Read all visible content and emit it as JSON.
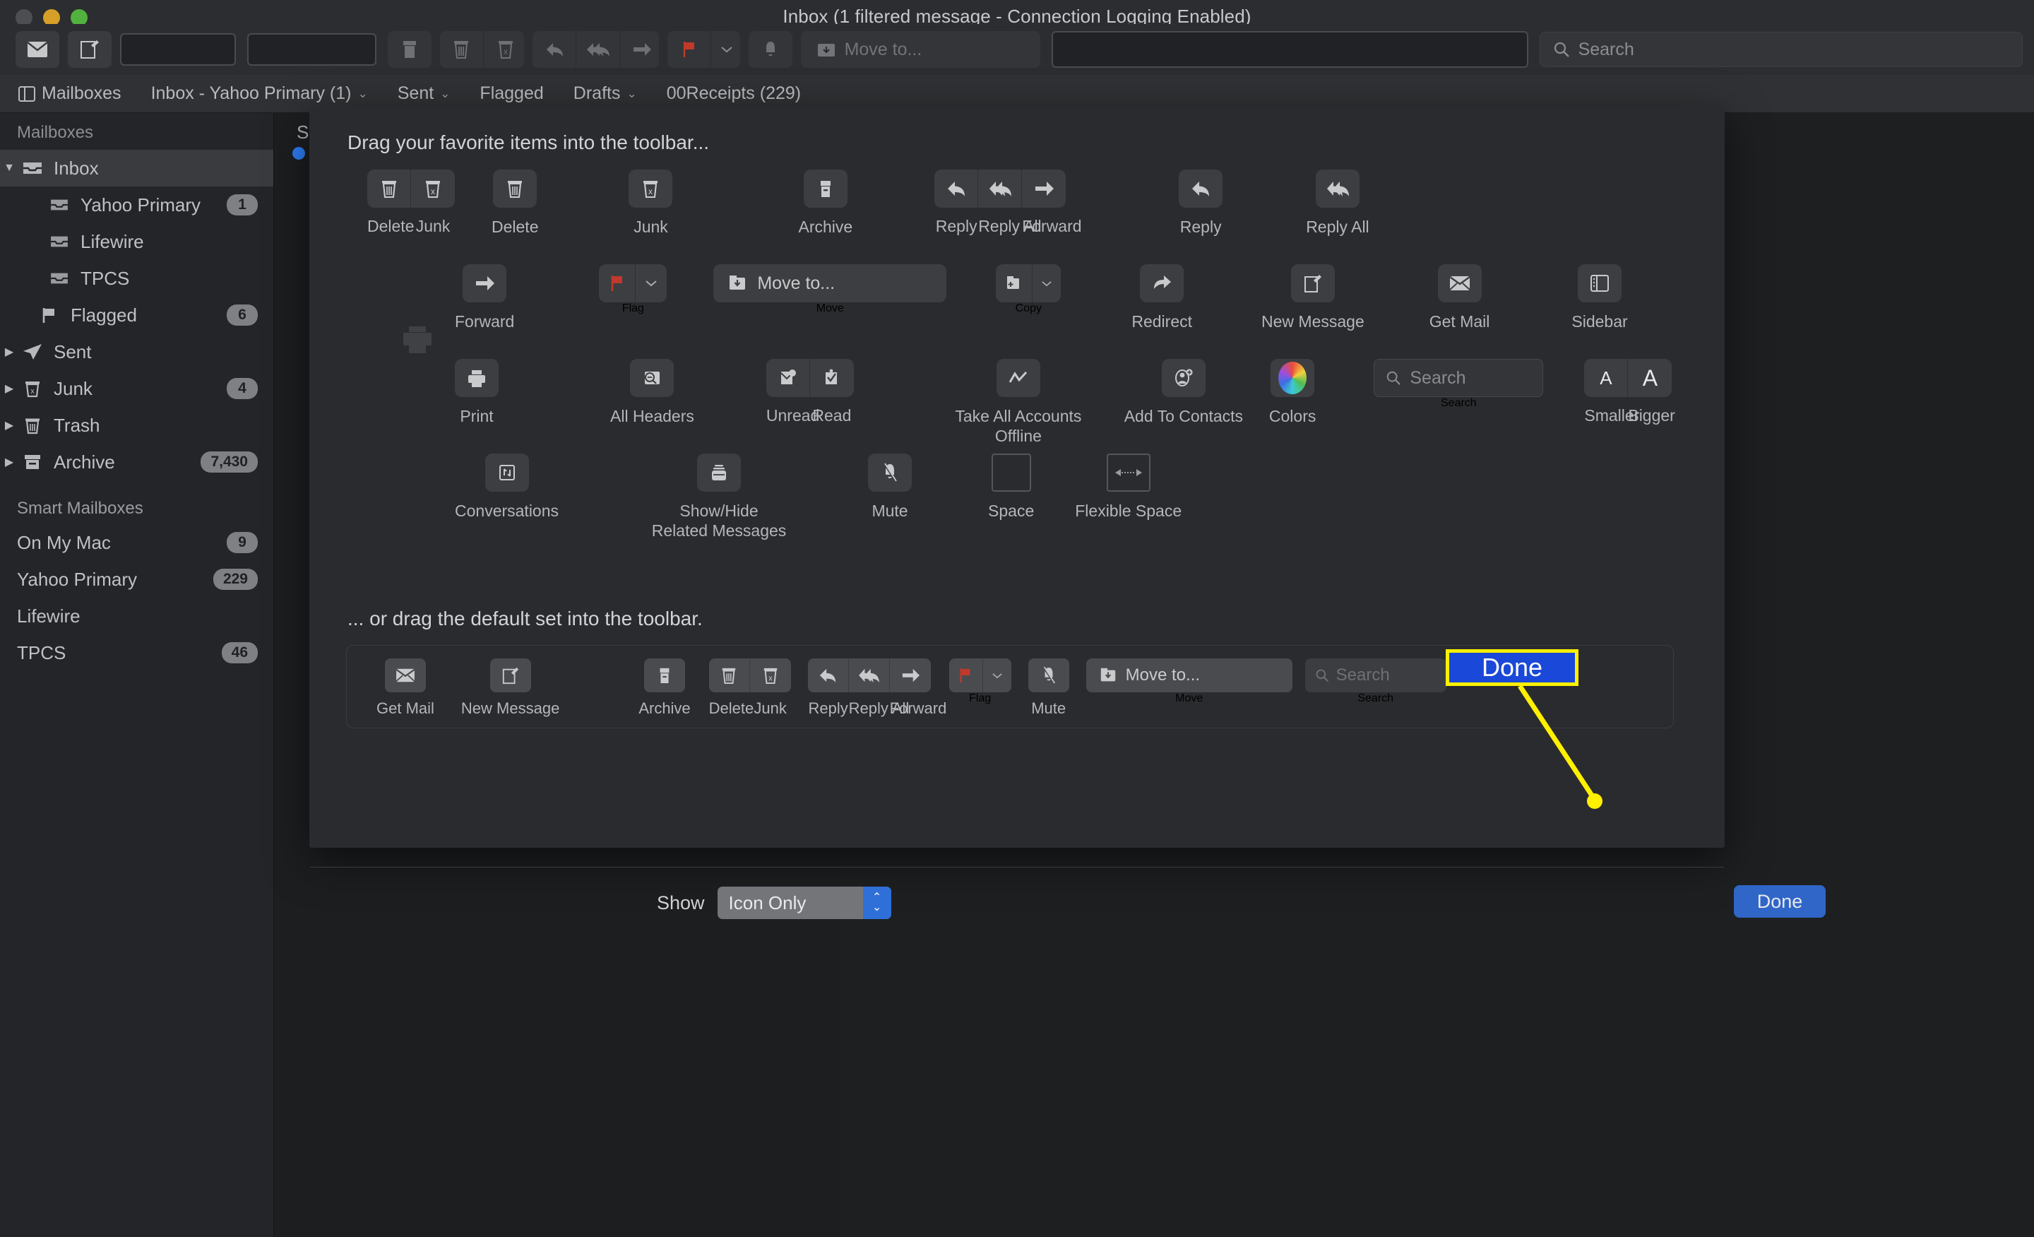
{
  "window": {
    "title": "Inbox (1 filtered message - Connection Logging Enabled)",
    "traffic_lights": [
      "close",
      "minimize",
      "zoom"
    ]
  },
  "toolbar": {
    "move_to_label": "Move to...",
    "search_placeholder": "Search",
    "buttons": [
      "get-mail",
      "new-message",
      "blank-1",
      "blank-2",
      "archive",
      "delete",
      "junk",
      "reply",
      "reply-all",
      "forward",
      "flag",
      "flag-menu",
      "mute",
      "move-to",
      "blank-field",
      "search"
    ]
  },
  "favorites_bar": {
    "items": [
      {
        "label": "Mailboxes",
        "icon": "sidebar-icon",
        "chevron": false
      },
      {
        "label": "Inbox - Yahoo Primary (1)",
        "icon": "",
        "chevron": true
      },
      {
        "label": "Sent",
        "icon": "",
        "chevron": true
      },
      {
        "label": "Flagged",
        "icon": "",
        "chevron": false
      },
      {
        "label": "Drafts",
        "icon": "",
        "chevron": true
      },
      {
        "label": "00Receipts (229)",
        "icon": "",
        "chevron": false
      }
    ]
  },
  "sidebar": {
    "header": "Mailboxes",
    "items": [
      {
        "label": "Inbox",
        "icon": "inbox-icon",
        "count": "",
        "indent": 0,
        "disclosure": "open",
        "selected": true
      },
      {
        "label": "Yahoo Primary",
        "icon": "inbox-icon",
        "count": "1",
        "indent": 1,
        "disclosure": "none",
        "selected": false
      },
      {
        "label": "Lifewire",
        "icon": "inbox-icon",
        "count": "",
        "indent": 1,
        "disclosure": "none",
        "selected": false
      },
      {
        "label": "TPCS",
        "icon": "inbox-icon",
        "count": "",
        "indent": 1,
        "disclosure": "none",
        "selected": false
      },
      {
        "label": "Flagged",
        "icon": "flag-icon",
        "count": "6",
        "indent": 0,
        "disclosure": "none",
        "selected": false
      },
      {
        "label": "Sent",
        "icon": "sent-icon",
        "count": "",
        "indent": 0,
        "disclosure": "closed",
        "selected": false
      },
      {
        "label": "Junk",
        "icon": "junk-icon",
        "count": "4",
        "indent": 0,
        "disclosure": "closed",
        "selected": false
      },
      {
        "label": "Trash",
        "icon": "trash-icon",
        "count": "",
        "indent": 0,
        "disclosure": "closed",
        "selected": false
      },
      {
        "label": "Archive",
        "icon": "archive-icon",
        "count": "7,430",
        "indent": 0,
        "disclosure": "closed",
        "selected": false
      }
    ],
    "section_header": "Smart Mailboxes",
    "smart_items": [
      {
        "label": "On My Mac",
        "count": "9"
      },
      {
        "label": "Yahoo Primary",
        "count": "229"
      },
      {
        "label": "Lifewire",
        "count": ""
      },
      {
        "label": "TPCS",
        "count": "46"
      }
    ]
  },
  "message_list": {
    "column_header": "S"
  },
  "sheet": {
    "title": "Drag your favorite items into the toolbar...",
    "title2": "... or drag the default set into the toolbar.",
    "palette_rows": [
      [
        {
          "type": "group",
          "segments": [
            {
              "icon": "trash-icon",
              "label": "Delete"
            },
            {
              "icon": "junk-icon",
              "label": "Junk"
            }
          ]
        },
        {
          "type": "item",
          "icon": "trash-icon",
          "label": "Delete"
        },
        {
          "type": "item",
          "icon": "junk-icon",
          "label": "Junk"
        },
        {
          "type": "item",
          "icon": "archive-icon",
          "label": "Archive"
        },
        {
          "type": "group",
          "segments": [
            {
              "icon": "reply-icon",
              "label": "Reply"
            },
            {
              "icon": "reply-all-icon",
              "label": "Reply All"
            },
            {
              "icon": "forward-icon",
              "label": "Forward"
            }
          ]
        },
        {
          "type": "item",
          "icon": "reply-icon",
          "label": "Reply"
        },
        {
          "type": "item",
          "icon": "reply-all-icon",
          "label": "Reply All"
        }
      ],
      [
        {
          "type": "item",
          "icon": "forward-icon",
          "label": "Forward"
        },
        {
          "type": "group",
          "segments": [
            {
              "icon": "flag-icon",
              "label": ""
            },
            {
              "icon": "chevron-down-icon",
              "label": ""
            }
          ],
          "grouplabel": "Flag"
        },
        {
          "type": "wide",
          "icon": "move-to-icon",
          "text": "Move to...",
          "label": "Move"
        },
        {
          "type": "group",
          "segments": [
            {
              "icon": "copy-folder-icon",
              "label": ""
            },
            {
              "icon": "chevron-down-icon",
              "label": ""
            }
          ],
          "grouplabel": "Copy"
        },
        {
          "type": "item",
          "icon": "redirect-icon",
          "label": "Redirect"
        },
        {
          "type": "item",
          "icon": "new-message-icon",
          "label": "New Message"
        },
        {
          "type": "item",
          "icon": "get-mail-icon",
          "label": "Get Mail"
        },
        {
          "type": "item",
          "icon": "sidebar-icon",
          "label": "Sidebar"
        }
      ],
      [
        {
          "type": "item",
          "icon": "print-icon",
          "label": "Print"
        },
        {
          "type": "item",
          "icon": "all-headers-icon",
          "label": "All Headers"
        },
        {
          "type": "group",
          "segments": [
            {
              "icon": "unread-icon",
              "label": "Unread"
            },
            {
              "icon": "read-icon",
              "label": "Read"
            }
          ]
        },
        {
          "type": "item",
          "icon": "offline-icon",
          "label": "Take All Accounts\nOffline"
        },
        {
          "type": "item",
          "icon": "add-contact-icon",
          "label": "Add To Contacts"
        },
        {
          "type": "item",
          "icon": "colors-icon",
          "label": "Colors"
        },
        {
          "type": "searchitem",
          "icon": "search-icon",
          "placeholder": "Search",
          "label": "Search"
        },
        {
          "type": "group",
          "segments": [
            {
              "icon": "smaller-A-icon",
              "label": "Smaller"
            },
            {
              "icon": "bigger-A-icon",
              "label": "Bigger"
            }
          ]
        }
      ],
      [
        {
          "type": "item",
          "icon": "conversations-icon",
          "label": "Conversations"
        },
        {
          "type": "item",
          "icon": "related-messages-icon",
          "label": "Show/Hide\nRelated Messages"
        },
        {
          "type": "item",
          "icon": "mute-icon",
          "label": "Mute"
        },
        {
          "type": "spaceitem",
          "icon": "space-icon",
          "label": "Space"
        },
        {
          "type": "spaceitem",
          "icon": "flexible-space-icon",
          "label": "Flexible Space"
        }
      ]
    ],
    "default_set": [
      {
        "type": "item",
        "icon": "get-mail-icon",
        "label": "Get Mail"
      },
      {
        "type": "item",
        "icon": "new-message-icon",
        "label": "New Message"
      },
      {
        "type": "item",
        "icon": "archive-icon",
        "label": "Archive"
      },
      {
        "type": "group",
        "segments": [
          {
            "icon": "trash-icon",
            "label": "Delete"
          },
          {
            "icon": "junk-icon",
            "label": "Junk"
          }
        ]
      },
      {
        "type": "group",
        "segments": [
          {
            "icon": "reply-icon",
            "label": "Reply"
          },
          {
            "icon": "reply-all-icon",
            "label": "Reply All"
          },
          {
            "icon": "forward-icon",
            "label": "Forward"
          }
        ]
      },
      {
        "type": "group",
        "segments": [
          {
            "icon": "flag-icon",
            "label": ""
          },
          {
            "icon": "chevron-down-icon",
            "label": ""
          }
        ],
        "grouplabel": "Flag"
      },
      {
        "type": "item",
        "icon": "mute-icon",
        "label": "Mute"
      },
      {
        "type": "wide",
        "icon": "move-to-icon",
        "text": "Move to...",
        "label": "Move"
      },
      {
        "type": "searchitem",
        "icon": "search-icon",
        "placeholder": "Search",
        "label": "Search"
      }
    ],
    "show_label": "Show",
    "show_value": "Icon Only",
    "done_label": "Done"
  },
  "annotation": {
    "callout_label": "Done",
    "highlight_color": "#fff000",
    "callout_bg": "#1a48d8",
    "line_color": "#fff000"
  }
}
